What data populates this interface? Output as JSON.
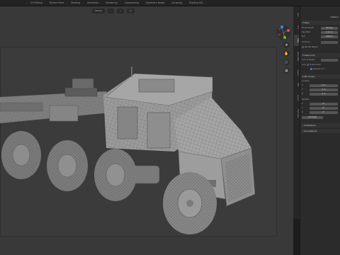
{
  "workspaces": {
    "tabs": [
      "UV Editing",
      "Texture Paint",
      "Shading",
      "Animation",
      "Rendering",
      "Compositing",
      "Geometry Nodes",
      "Scripting",
      "Shading.001"
    ],
    "active_index": 0
  },
  "viewport": {
    "header": {
      "mode_label": "Global",
      "pivot_label": ""
    },
    "tools": [
      "✥",
      "✋",
      "🎥",
      "▦"
    ]
  },
  "sidebar": {
    "tabs": [
      "Item",
      "Tool",
      "View",
      "Sketchfab",
      "Create",
      "Edit",
      "Import",
      "Hard Ops"
    ],
    "active_tab": "View",
    "top_label": "Options",
    "view_panel": {
      "title": "View",
      "focal_label": "Focal Length",
      "focal_value": "50 mm",
      "clip_start_label": "Clip Start",
      "clip_start_value": "0.01 m",
      "clip_end_label": "End",
      "clip_end_value": "1000 m",
      "local_camera_label": "Local Ca...",
      "render_region_label": "Render Region",
      "view_lock_label": "View Lock",
      "lock_object_label": "Lock to Object",
      "lock_label": "Lock",
      "lock_cursor": "To 3D Cursor",
      "lock_camera": "Camera to V..."
    },
    "cursor_panel": {
      "title": "3D Cursor",
      "location_label": "Location",
      "loc": [
        {
          "axis": "X",
          "value": "0 m"
        },
        {
          "axis": "Y",
          "value": "0 m"
        },
        {
          "axis": "Z",
          "value": "0 m"
        }
      ],
      "rotation_label": "Rotation",
      "rot": [
        {
          "axis": "X",
          "value": "0°"
        },
        {
          "axis": "Y",
          "value": "0°"
        },
        {
          "axis": "Z",
          "value": "0°"
        }
      ],
      "rotation_mode": "XYZ Euler"
    },
    "collapsed": [
      "Collections",
      "Annotations"
    ]
  },
  "colors": {
    "accent": "#4772b3",
    "viewport_bg": "#393939",
    "panel_bg": "#2b2b2b",
    "model": "#8c8c8c"
  }
}
